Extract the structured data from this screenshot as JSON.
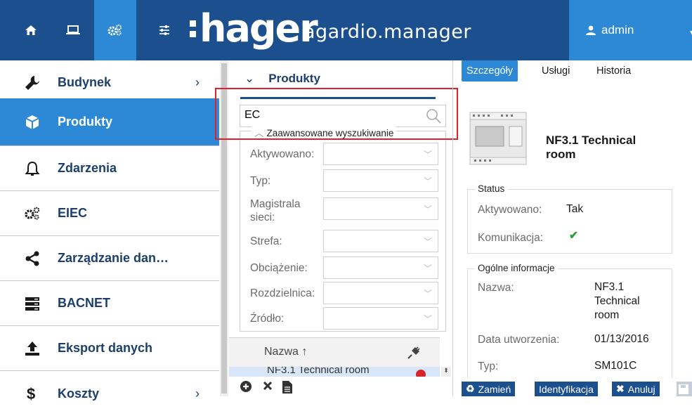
{
  "header": {
    "logo": "hager",
    "app_name": "agardio.manager",
    "user": "admin",
    "nav_icons": [
      "home-icon",
      "laptop-icon",
      "gears-icon",
      "sliders-icon"
    ]
  },
  "sidebar": {
    "items": [
      {
        "label": "Budynek",
        "icon": "wrench-icon",
        "chevron": "›"
      },
      {
        "label": "Produkty",
        "icon": "cube-icon",
        "chevron": ""
      },
      {
        "label": "Zdarzenia",
        "icon": "bell-icon",
        "chevron": ""
      },
      {
        "label": "EIEC",
        "icon": "gears-icon",
        "chevron": ""
      },
      {
        "label": "Zarządzanie dan…",
        "icon": "share-icon",
        "chevron": ""
      },
      {
        "label": "BACNET",
        "icon": "server-icon",
        "chevron": ""
      },
      {
        "label": "Eksport danych",
        "icon": "upload-icon",
        "chevron": ""
      },
      {
        "label": "Koszty",
        "icon": "dollar-icon",
        "chevron": "›"
      }
    ]
  },
  "products": {
    "title": "Produkty",
    "search_value": "EC",
    "advanced_title": "Zaawansowane wyszukiwanie",
    "filters": [
      {
        "label": "Aktywowano:"
      },
      {
        "label": "Typ:"
      },
      {
        "label": "Magistrala sieci:"
      },
      {
        "label": "Strefa:"
      },
      {
        "label": "Obciążenie:"
      },
      {
        "label": "Rozdzielnica:"
      },
      {
        "label": "Źródło:"
      }
    ],
    "list_header": "Nazwa ↑",
    "list_row": "NF3.1 Technical room"
  },
  "details": {
    "tabs": [
      "Szczegóły",
      "Usługi",
      "Historia"
    ],
    "title": "NF3.1 Technical room",
    "status_legend": "Status",
    "activated_label": "Aktywowano:",
    "activated_value": "Tak",
    "comm_label": "Komunikacja:",
    "comm_value": "✔",
    "general_legend": "Ogólne informacje",
    "name_label": "Nazwa:",
    "name_value": "NF3.1 Technical room",
    "created_label": "Data utworzenia:",
    "created_value": "01/13/2016",
    "type_label": "Typ:",
    "type_value": "SM101C",
    "buttons": [
      "Zamień",
      "Identyfikacja",
      "Anuluj"
    ]
  },
  "colors": {
    "brand": "#1b4f8d",
    "accent": "#2d88d6",
    "highlight_box": "#e0202a",
    "ok": "#2e9e2e",
    "error": "#d7262b"
  }
}
